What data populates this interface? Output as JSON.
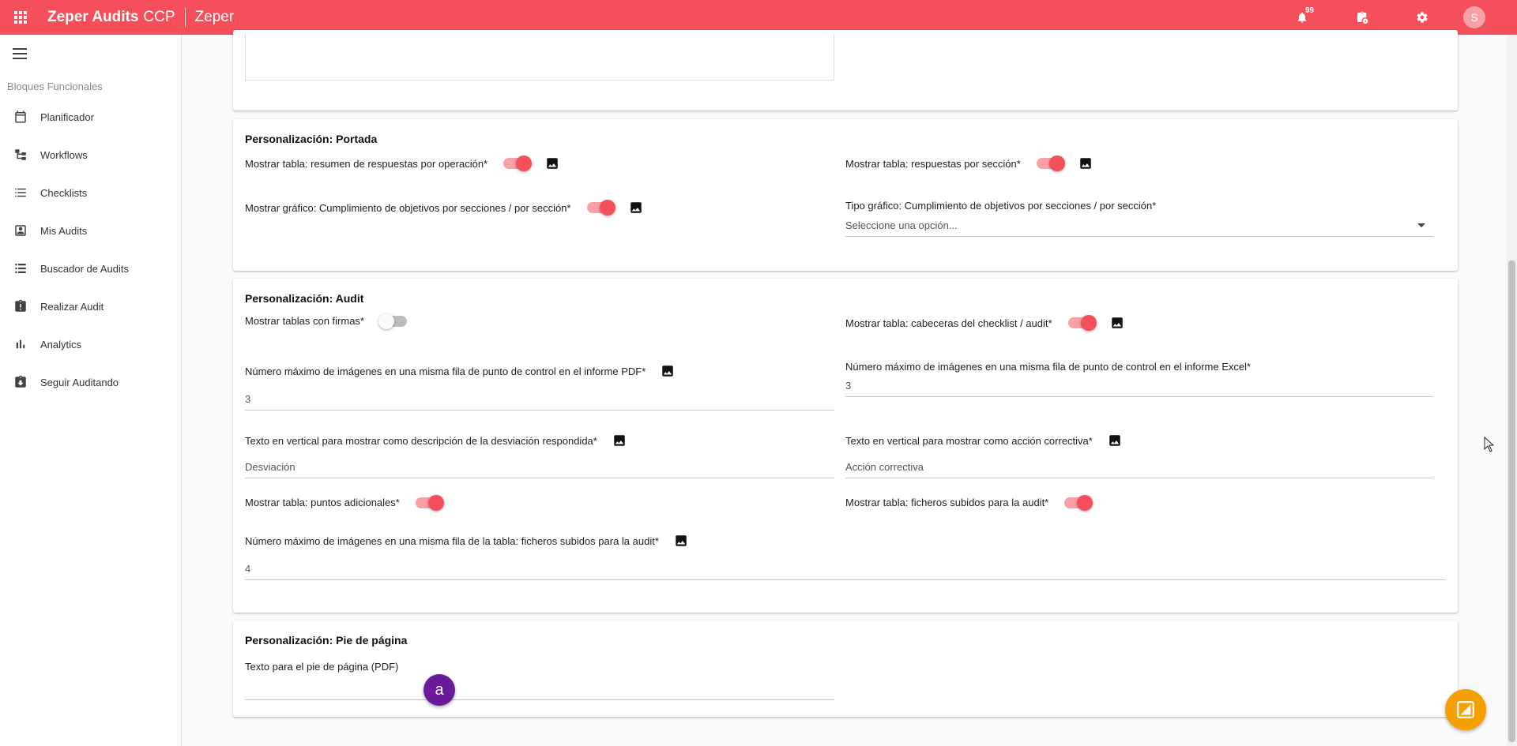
{
  "header": {
    "app_name": "Zeper Audits",
    "app_suffix": "CCP",
    "organization": "Zeper",
    "notifications_count": "99",
    "avatar_initial": "S",
    "accent_color": "#f44f5a"
  },
  "sidebar": {
    "heading": "Bloques Funcionales",
    "items": [
      {
        "label": "Planificador",
        "icon": "calendar-icon"
      },
      {
        "label": "Workflows",
        "icon": "workflow-icon"
      },
      {
        "label": "Checklists",
        "icon": "list-icon"
      },
      {
        "label": "Mis Audits",
        "icon": "person-box-icon"
      },
      {
        "label": "Buscador de Audits",
        "icon": "list-search-icon"
      },
      {
        "label": "Realizar Audit",
        "icon": "clipboard-alert-icon"
      },
      {
        "label": "Analytics",
        "icon": "bar-chart-icon"
      },
      {
        "label": "Seguir Auditando",
        "icon": "clipboard-download-icon"
      }
    ]
  },
  "portada": {
    "title": "Personalización: Portada",
    "resumen_respuestas_label": "Mostrar tabla: resumen de respuestas por operación*",
    "resumen_respuestas_on": true,
    "respuestas_seccion_label": "Mostrar tabla: respuestas por sección*",
    "respuestas_seccion_on": true,
    "grafico_cumplimiento_label": "Mostrar gráfico: Cumplimiento de objetivos por secciones / por sección*",
    "grafico_cumplimiento_on": true,
    "tipo_grafico_label": "Tipo gráfico: Cumplimiento de objetivos por secciones / por sección*",
    "tipo_grafico_placeholder": "Seleccione una opción..."
  },
  "audit": {
    "title": "Personalización: Audit",
    "tablas_firmas_label": "Mostrar tablas con firmas*",
    "tablas_firmas_on": false,
    "cabeceras_label": "Mostrar tabla: cabeceras del checklist / audit*",
    "cabeceras_on": true,
    "max_img_pdf_label": "Número máximo de imágenes en una misma fila de punto de control en el informe PDF*",
    "max_img_pdf_value": "3",
    "max_img_excel_label": "Número máximo de imágenes en una misma fila de punto de control en el informe Excel*",
    "max_img_excel_value": "3",
    "desviacion_label": "Texto en vertical para mostrar como descripción de la desviación respondida*",
    "desviacion_value": "Desviación",
    "accion_label": "Texto en vertical para mostrar como acción correctiva*",
    "accion_value": "Acción correctiva",
    "puntos_adicionales_label": "Mostrar tabla: puntos adicionales*",
    "puntos_adicionales_on": true,
    "ficheros_label": "Mostrar tabla: ficheros subidos para la audit*",
    "ficheros_on": true,
    "max_img_ficheros_label": "Número máximo de imágenes en una misma fila de la tabla: ficheros subidos para la audit*",
    "max_img_ficheros_value": "4"
  },
  "pie": {
    "title": "Personalización: Pie de página",
    "texto_label": "Texto para el pie de página (PDF)",
    "texto_value": ""
  },
  "floating": {
    "user_bubble": "a",
    "support_color": "#f6a000"
  }
}
